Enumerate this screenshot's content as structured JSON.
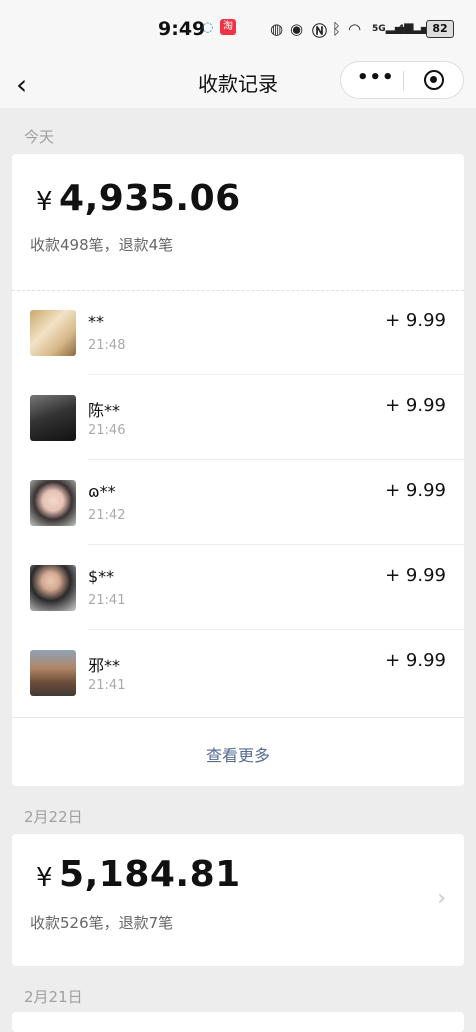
{
  "status": {
    "time": "9:49",
    "battery": "82",
    "icons": [
      "message-icon",
      "taobao-icon",
      "nfc-icon",
      "eye-icon",
      "n-icon",
      "bluetooth-icon",
      "wifi-icon",
      "5g-signal-icon",
      "4g-signal-icon",
      "battery-icon"
    ],
    "sig_5g": "5G",
    "sig_4g": "4G",
    "taobao_glyph": "淘"
  },
  "nav": {
    "back_glyph": "‹",
    "title": "收款记录",
    "more_glyph": "•••"
  },
  "today": {
    "date": "今天",
    "yen": "¥",
    "amount": "4,935.06",
    "summary": "收款498笔，退款4笔",
    "payments": [
      {
        "name": "**",
        "time": "21:48",
        "amount": "+ 9.99"
      },
      {
        "name": "陈**",
        "time": "21:46",
        "amount": "+ 9.99"
      },
      {
        "name": "ɷ**",
        "time": "21:42",
        "amount": "+ 9.99"
      },
      {
        "name": "$**",
        "time": "21:41",
        "amount": "+ 9.99"
      },
      {
        "name": "邪**",
        "time": "21:41",
        "amount": "+ 9.99"
      }
    ],
    "view_more": "查看更多"
  },
  "day2": {
    "date": "2月22日",
    "yen": "¥",
    "amount": "5,184.81",
    "summary": "收款526笔，退款7笔",
    "chevron": "›"
  },
  "day3": {
    "date": "2月21日"
  }
}
